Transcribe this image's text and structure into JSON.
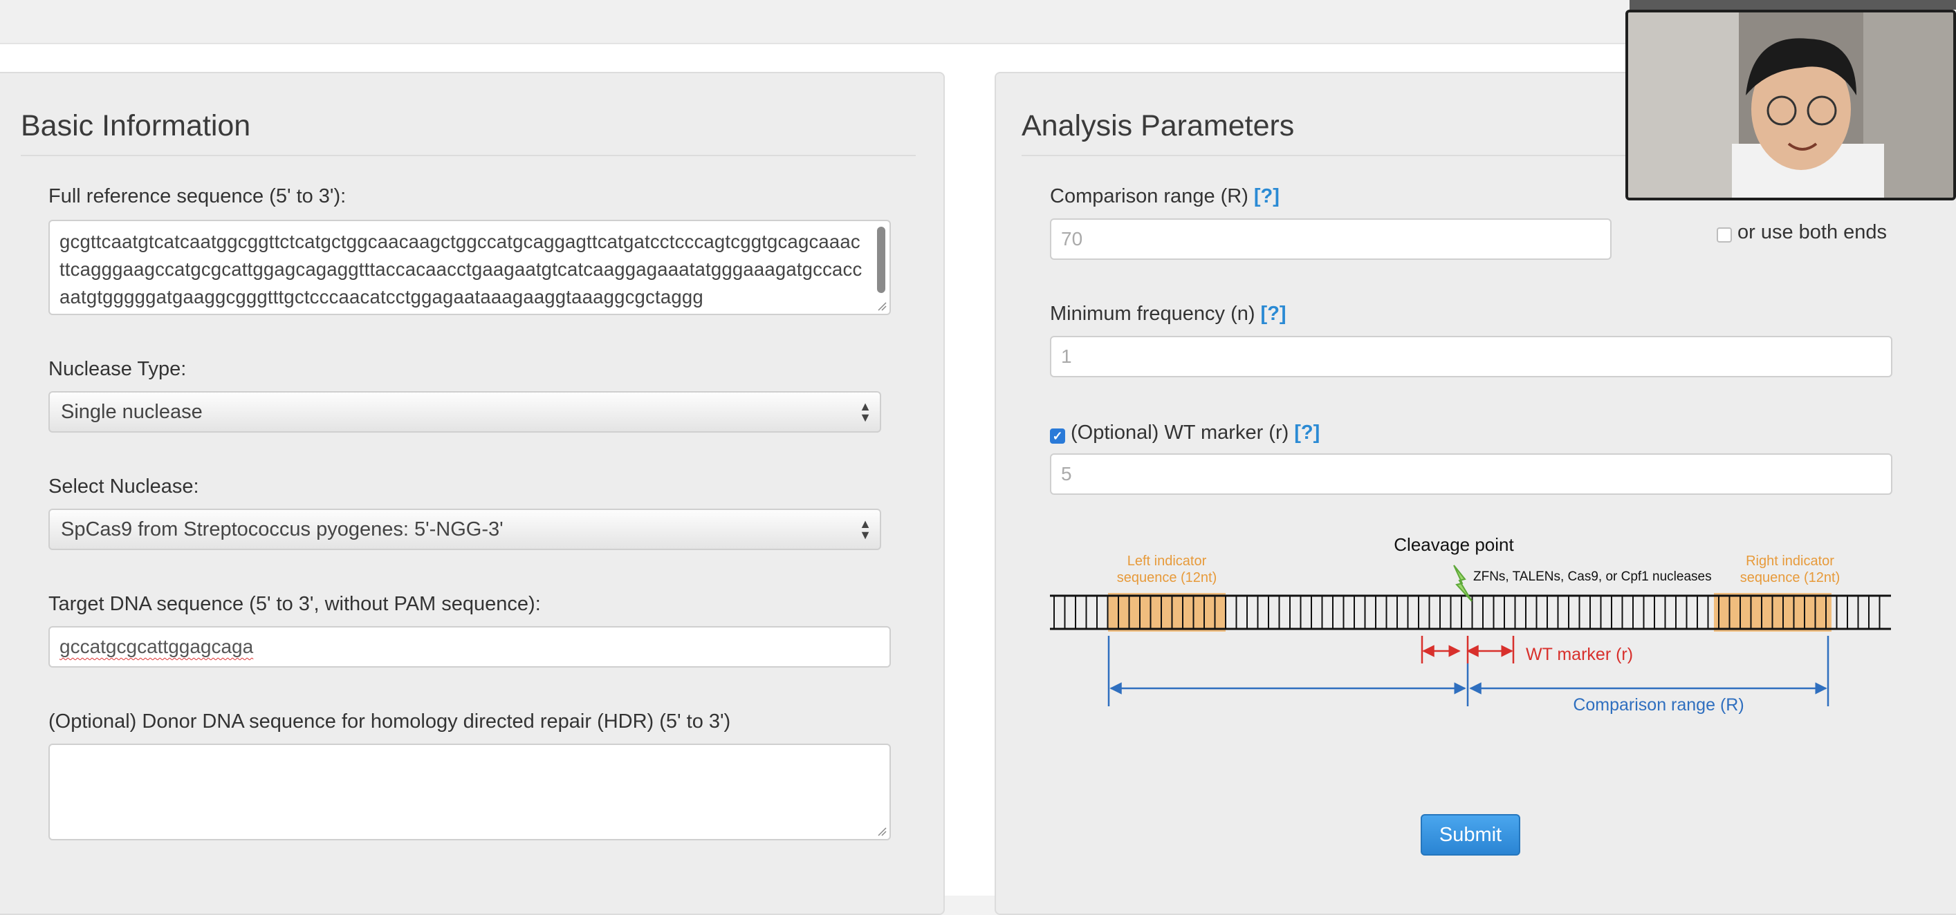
{
  "basic_info": {
    "title": "Basic Information",
    "ref_seq_label": "Full reference sequence (5' to 3'):",
    "ref_seq_value": "gcgttcaatgtcatcaatggcggttctcatgctggcaacaagctggccatgcaggagttcatgatcctcccagtcggtgcagcaaac\nttcagggaagccatgcgcattggagcagaggtttaccacaacctgaagaatgtcatcaaggagaaatatgggaaagatgccacc\naatgtgggggatgaaggcgggtttgctcccaacatcctggagaataaagaaggtaaaggcgctaggg",
    "nuclease_type_label": "Nuclease Type:",
    "nuclease_type_value": "Single nuclease",
    "select_nuclease_label": "Select Nuclease:",
    "select_nuclease_value": "SpCas9 from Streptococcus pyogenes: 5'-NGG-3'",
    "target_label": "Target DNA sequence (5' to 3', without PAM sequence):",
    "target_value": "gccatgcgcattggagcaga",
    "donor_label": "(Optional) Donor DNA sequence for homology directed repair (HDR) (5' to 3')",
    "donor_value": ""
  },
  "analysis": {
    "title": "Analysis Parameters",
    "comparison_label": "Comparison range (R)",
    "help_text": "[?]",
    "comparison_placeholder": "70",
    "both_ends_label": "or use both ends",
    "both_ends_checked": false,
    "min_freq_label": "Minimum frequency (n)",
    "min_freq_placeholder": "1",
    "wt_marker_label": "(Optional) WT marker (r)",
    "wt_marker_checked": true,
    "wt_marker_placeholder": "5",
    "submit_label": "Submit"
  },
  "diagram": {
    "cleavage_point": "Cleavage point",
    "nucleases": "ZFNs, TALENs, Cas9, or Cpf1 nucleases",
    "left_indicator_1": "Left indicator",
    "left_indicator_2": "sequence (12nt)",
    "right_indicator_1": "Right indicator",
    "right_indicator_2": "sequence (12nt)",
    "wt_marker": "WT marker (r)",
    "comparison_range": "Comparison range (R)",
    "colors": {
      "indicator": "#f0b46a",
      "wt": "#d8302c",
      "range": "#2f6fbf",
      "bolt": "#9bd86a"
    }
  }
}
